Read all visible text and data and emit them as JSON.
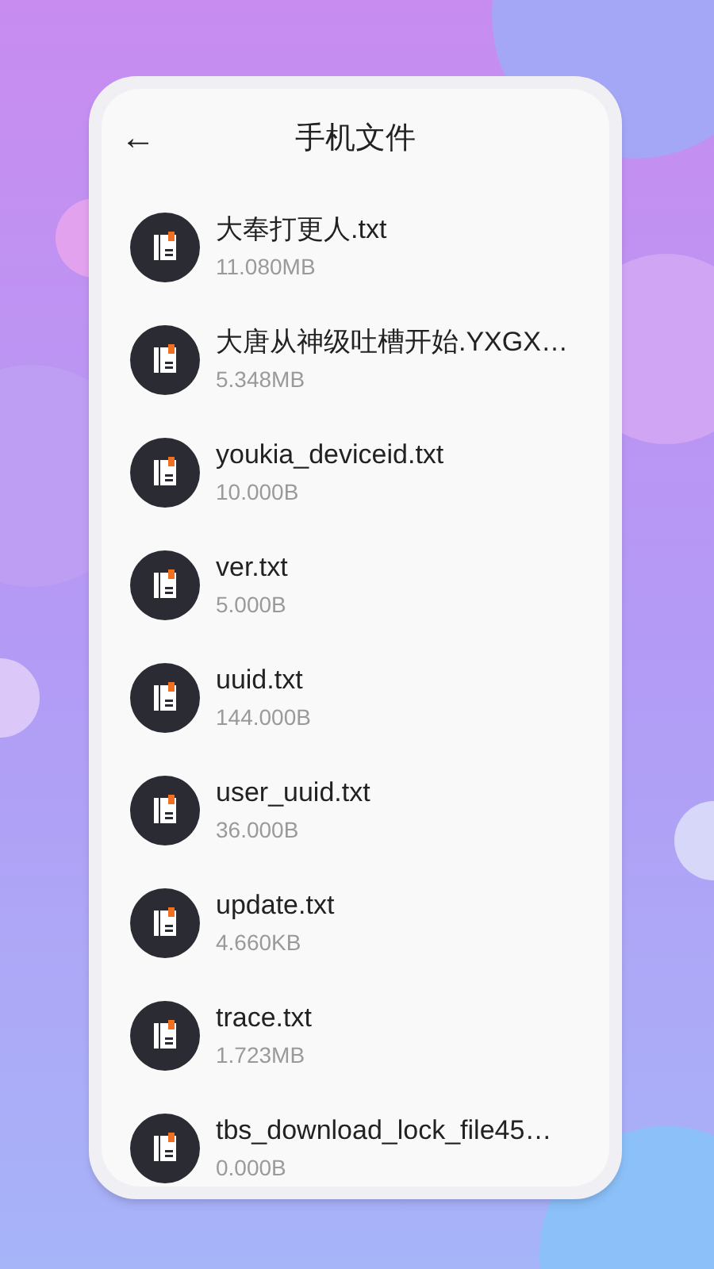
{
  "header": {
    "back_icon": "←",
    "title": "手机文件"
  },
  "files": [
    {
      "name": "大奉打更人.txt",
      "size": "11.080MB"
    },
    {
      "name": "大唐从神级吐槽开始.YXGX…",
      "size": "5.348MB"
    },
    {
      "name": "youkia_deviceid.txt",
      "size": "10.000B"
    },
    {
      "name": "ver.txt",
      "size": "5.000B"
    },
    {
      "name": "uuid.txt",
      "size": "144.000B"
    },
    {
      "name": "user_uuid.txt",
      "size": "36.000B"
    },
    {
      "name": "update.txt",
      "size": "4.660KB"
    },
    {
      "name": "trace.txt",
      "size": "1.723MB"
    },
    {
      "name": "tbs_download_lock_file45…",
      "size": "0.000B"
    }
  ]
}
